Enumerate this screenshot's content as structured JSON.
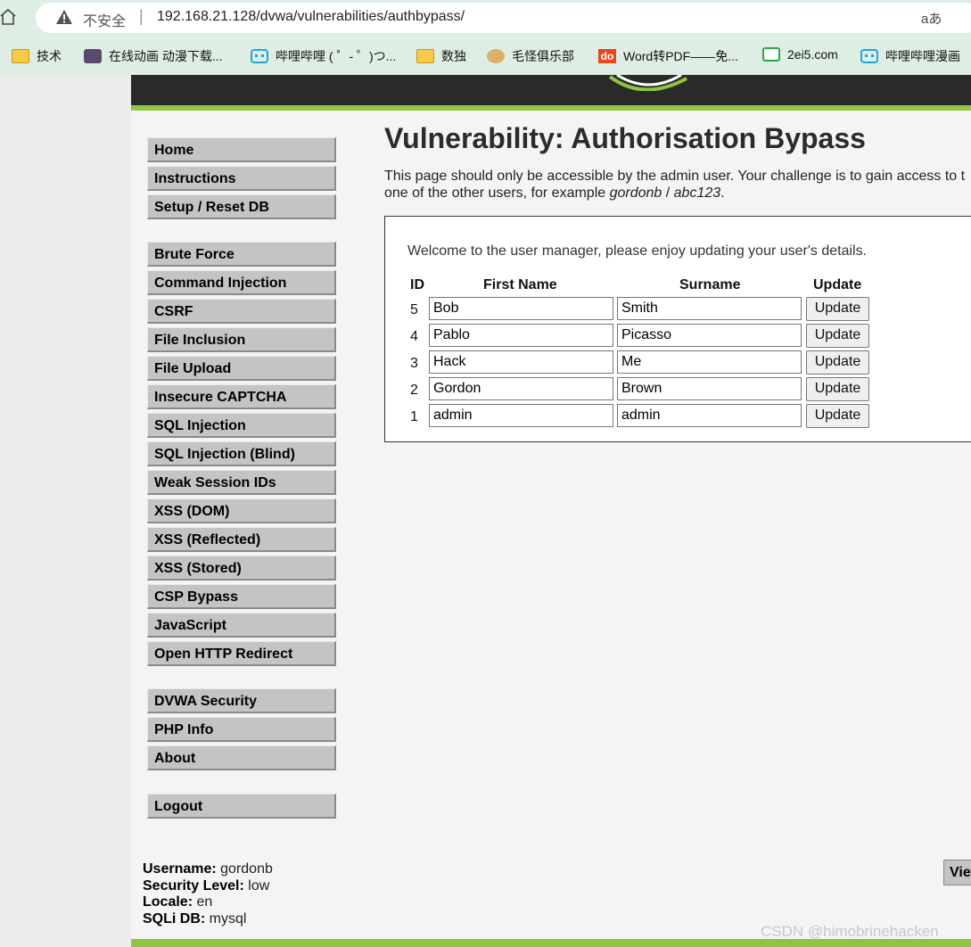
{
  "browser": {
    "insecure_label": "不安全",
    "separator": "|",
    "url": "192.168.21.128/dvwa/vulnerabilities/authbypass/",
    "read_aloud": "aあ"
  },
  "bookmarks": [
    {
      "label": "技术",
      "icon": "folder-icon"
    },
    {
      "label": "在线动画 动漫下载...",
      "icon": "avatar-icon"
    },
    {
      "label": "哔哩哔哩 ( ゜- ゜)つ...",
      "icon": "bilibili-icon"
    },
    {
      "label": "数独",
      "icon": "folder-icon"
    },
    {
      "label": "毛怪俱乐部",
      "icon": "club-icon"
    },
    {
      "label": "Word转PDF——免...",
      "icon": "do-icon",
      "badge": "do"
    },
    {
      "label": "2ei5.com",
      "icon": "leaf-icon"
    },
    {
      "label": "哔哩哔哩漫画",
      "icon": "bilibili-icon"
    }
  ],
  "menu": {
    "home": "Home",
    "instructions": "Instructions",
    "setup": "Setup / Reset DB",
    "brute_force": "Brute Force",
    "command_injection": "Command Injection",
    "csrf": "CSRF",
    "file_inclusion": "File Inclusion",
    "file_upload": "File Upload",
    "insecure_captcha": "Insecure CAPTCHA",
    "sql_injection": "SQL Injection",
    "sql_injection_blind": "SQL Injection (Blind)",
    "weak_session_ids": "Weak Session IDs",
    "xss_dom": "XSS (DOM)",
    "xss_reflected": "XSS (Reflected)",
    "xss_stored": "XSS (Stored)",
    "csp_bypass": "CSP Bypass",
    "javascript": "JavaScript",
    "open_redirect": "Open HTTP Redirect",
    "dvwa_security": "DVWA Security",
    "php_info": "PHP Info",
    "about": "About",
    "logout": "Logout"
  },
  "main": {
    "title": "Vulnerability: Authorisation Bypass",
    "intro_line1": "This page should only be accessible by the admin user. Your challenge is to gain access to t",
    "intro_line2_prefix": "one of the other users, for example ",
    "intro_user": "gordonb",
    "intro_slash": " / ",
    "intro_pass": "abc123",
    "intro_end": ".",
    "welcome": "Welcome to the user manager, please enjoy updating your user's details.",
    "headers": {
      "id": "ID",
      "first": "First Name",
      "surname": "Surname",
      "update": "Update"
    },
    "rows": [
      {
        "id": "5",
        "first": "Bob",
        "surname": "Smith",
        "button": "Update"
      },
      {
        "id": "4",
        "first": "Pablo",
        "surname": "Picasso",
        "button": "Update"
      },
      {
        "id": "3",
        "first": "Hack",
        "surname": "Me",
        "button": "Update"
      },
      {
        "id": "2",
        "first": "Gordon",
        "surname": "Brown",
        "button": "Update"
      },
      {
        "id": "1",
        "first": "admin",
        "surname": "admin",
        "button": "Update"
      }
    ]
  },
  "footer": {
    "username_label": "Username:",
    "username": "gordonb",
    "security_label": "Security Level:",
    "security": "low",
    "locale_label": "Locale:",
    "locale": "en",
    "sqli_label": "SQLi DB:",
    "sqli": "mysql",
    "view_button": "Vie"
  },
  "watermark": "CSDN @himobrinehacken"
}
